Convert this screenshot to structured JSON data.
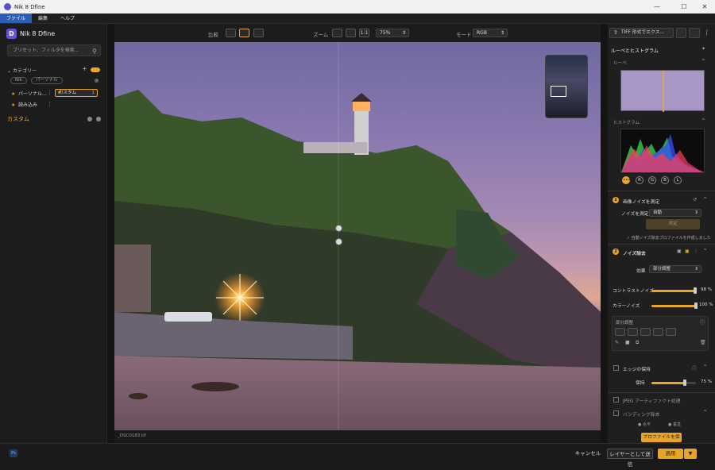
{
  "window": {
    "title": "Nik 8 Dfine"
  },
  "menu": [
    "ファイル",
    "編集",
    "ヘルプ"
  ],
  "left": {
    "app_name": "Nik 8 Dfine",
    "search_placeholder": "プリセット、フィルタを検索...",
    "categories_label": "カテゴリー",
    "filters": [
      "Nik",
      "パーソナル"
    ],
    "presets": [
      {
        "label": "パーソナル..."
      },
      {
        "label": "カスタム",
        "count": "1"
      },
      {
        "label": "読み込み"
      }
    ],
    "custom_label": "カスタム"
  },
  "toolbar": {
    "compare_label": "比較",
    "zoom_label": "ズーム",
    "zoom_1to1": "1:1",
    "zoom_value": "75%",
    "mode_label": "モード",
    "mode_value": "RGB"
  },
  "image": {
    "filename": "_DSC0183.tif"
  },
  "right": {
    "export_label": "TIFF 形式でエクス...",
    "loupe_histogram_title": "ルーペとヒストグラム",
    "loupe_label": "ルーペ",
    "histogram_label": "ヒストグラム",
    "channels": [
      "•••",
      "R",
      "G",
      "B",
      "L"
    ],
    "s1_title": "画像ノイズを測定",
    "measure_label": "ノイズを測定",
    "measure_mode": "自動",
    "measure_button": "測定",
    "auto_note": "自動ノイズ除去プロファイルを作成しました",
    "s2_title": "ノイズ除去",
    "effect_label": "効果",
    "effect_value": "部分調整",
    "contrast_label": "コントラストノイズ",
    "contrast_pct": "98 %",
    "color_label": "カラーノイズ",
    "color_pct": "100 %",
    "contrast_value": 0.98,
    "color_value": 1.0,
    "partial_label": "部分調整",
    "edge_label": "エッジの保持",
    "keep_label": "保持",
    "keep_pct": "75 %",
    "keep_value": 0.75,
    "jpeg_label": "JPEG アーティファクト処理",
    "banding_label": "バンディング除去",
    "banding_sub1": "水平",
    "banding_sub2": "垂直",
    "save_profile": "プロファイルを保存"
  },
  "bottom": {
    "ps": "Ps",
    "cancel": "キャンセル",
    "layer": "レイヤーとして送信",
    "apply": "適用"
  },
  "colors": {
    "accent": "#e9a52a",
    "menu_active": "#2b5fb8"
  }
}
